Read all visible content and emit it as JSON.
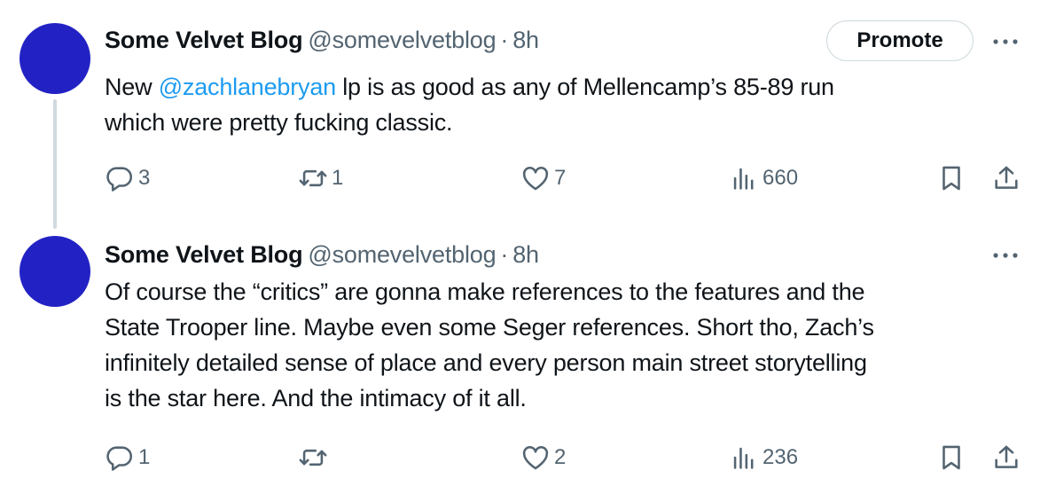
{
  "tweets": [
    {
      "author_name": "Some Velvet Blog",
      "handle": "@somevelvetblog",
      "separator": "·",
      "time": "8h",
      "promote_label": "Promote",
      "text_prefix": "New ",
      "mention": "@zachlanebryan",
      "text_line1_rest": " lp is as good as any of Mellencamp’s 85-89 run",
      "text_line2": "which were pretty fucking classic.",
      "replies": "3",
      "reposts": "1",
      "likes": "7",
      "views": "660"
    },
    {
      "author_name": "Some Velvet Blog",
      "handle": "@somevelvetblog",
      "separator": "·",
      "time": "8h",
      "text_lines": [
        "Of course the “critics” are gonna make references to the features and the",
        "State Trooper line. Maybe even some Seger references. Short tho, Zach’s",
        "infinitely detailed sense of place and every person main street storytelling",
        "is the star here. And the intimacy of it all."
      ],
      "replies": "1",
      "reposts": "",
      "likes": "2",
      "views": "236"
    }
  ],
  "colors": {
    "avatar": "#2222c4",
    "mention": "#1d9bf0",
    "muted": "#536471",
    "text": "#0f1419",
    "thread_line": "#cfd9de"
  },
  "icons": [
    "reply-icon",
    "repost-icon",
    "like-icon",
    "views-icon",
    "bookmark-icon",
    "share-icon",
    "more-icon"
  ]
}
